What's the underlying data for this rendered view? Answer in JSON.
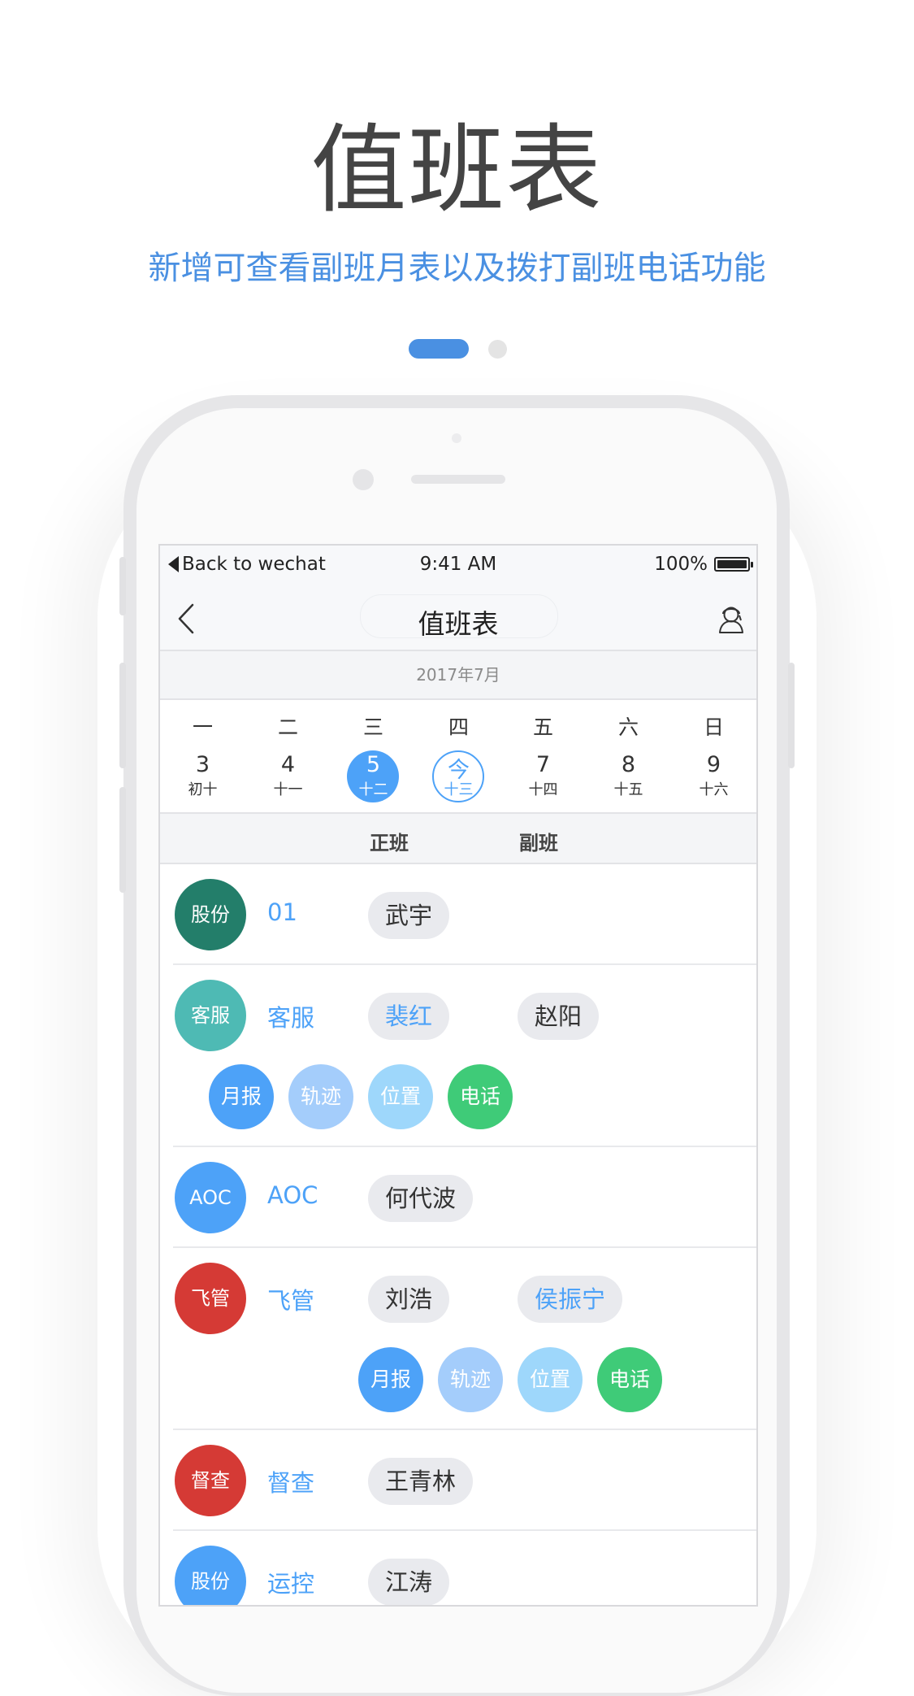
{
  "hero": {
    "title": "值班表",
    "subtitle": "新增可查看副班月表以及拨打副班电话功能"
  },
  "status_bar": {
    "back_label": "Back to wechat",
    "time": "9:41 AM",
    "battery": "100%"
  },
  "nav": {
    "title": "值班表"
  },
  "calendar": {
    "month": "2017年7月",
    "weekdays": [
      "一",
      "二",
      "三",
      "四",
      "五",
      "六",
      "日"
    ],
    "days": [
      {
        "num": "3",
        "lunar": "初十"
      },
      {
        "num": "4",
        "lunar": "十一"
      },
      {
        "num": "5",
        "lunar": "十二",
        "state": "selected"
      },
      {
        "num": "今",
        "lunar": "十三",
        "state": "today"
      },
      {
        "num": "7",
        "lunar": "十四"
      },
      {
        "num": "8",
        "lunar": "十五"
      },
      {
        "num": "9",
        "lunar": "十六"
      }
    ]
  },
  "columns": {
    "main": "正班",
    "deputy": "副班"
  },
  "actions": {
    "report": "月报",
    "track": "轨迹",
    "location": "位置",
    "phone": "电话"
  },
  "rows": [
    {
      "avatar": "股份",
      "avatar_color": "#237e6a",
      "dept": "01",
      "main": "武宇",
      "deputy": ""
    },
    {
      "avatar": "客服",
      "avatar_color": "#4ebab4",
      "dept": "客服",
      "main": "裴红",
      "deputy": "赵阳"
    },
    {
      "avatar": "AOC",
      "avatar_color": "#4da2f8",
      "dept": "AOC",
      "main": "何代波",
      "deputy": ""
    },
    {
      "avatar": "飞管",
      "avatar_color": "#d53a35",
      "dept": "飞管",
      "main": "刘浩",
      "deputy": "侯振宁"
    },
    {
      "avatar": "督查",
      "avatar_color": "#d53a35",
      "dept": "督查",
      "main": "王青林",
      "deputy": ""
    },
    {
      "avatar": "股份",
      "avatar_color": "#4da2f8",
      "dept": "运控",
      "main": "江涛",
      "deputy": ""
    }
  ],
  "colors": {
    "accent": "#4da2f8",
    "hero_subtitle": "#4a90e2",
    "phone_green": "#3fcb78"
  }
}
